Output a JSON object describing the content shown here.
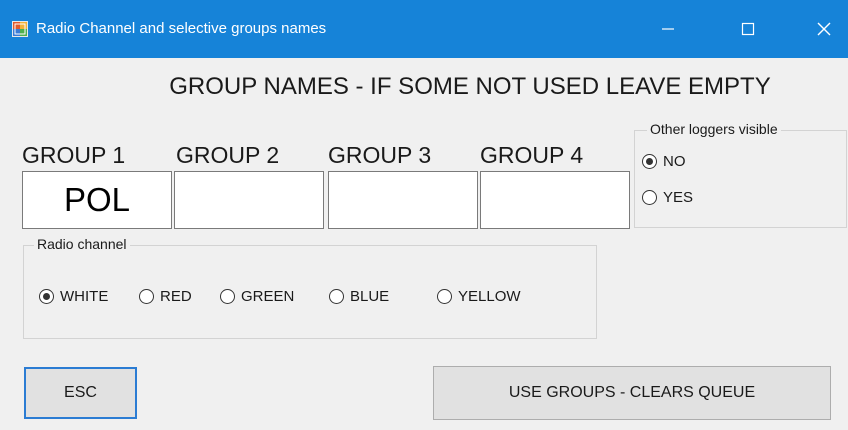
{
  "window": {
    "title": "Radio Channel and selective groups names",
    "controls": {
      "minimize_icon": "minimize-icon",
      "maximize_icon": "maximize-icon",
      "close_icon": "close-icon"
    },
    "colors": {
      "titlebar": "#1683d8",
      "background": "#f0f0f0",
      "focus_border": "#2b7cd3"
    }
  },
  "heading": "GROUP NAMES - IF SOME NOT USED LEAVE EMPTY",
  "groups": [
    {
      "label": "GROUP 1",
      "value": "POL"
    },
    {
      "label": "GROUP 2",
      "value": ""
    },
    {
      "label": "GROUP 3",
      "value": ""
    },
    {
      "label": "GROUP 4",
      "value": ""
    }
  ],
  "loggers": {
    "title": "Other loggers visible",
    "options": [
      {
        "label": "NO",
        "checked": true
      },
      {
        "label": "YES",
        "checked": false
      }
    ]
  },
  "radio_channel": {
    "title": "Radio channel",
    "options": [
      {
        "label": "WHITE",
        "checked": true
      },
      {
        "label": "RED",
        "checked": false
      },
      {
        "label": "GREEN",
        "checked": false
      },
      {
        "label": "BLUE",
        "checked": false
      },
      {
        "label": "YELLOW",
        "checked": false
      }
    ]
  },
  "buttons": {
    "esc": "ESC",
    "use_groups": "USE GROUPS - CLEARS QUEUE"
  }
}
